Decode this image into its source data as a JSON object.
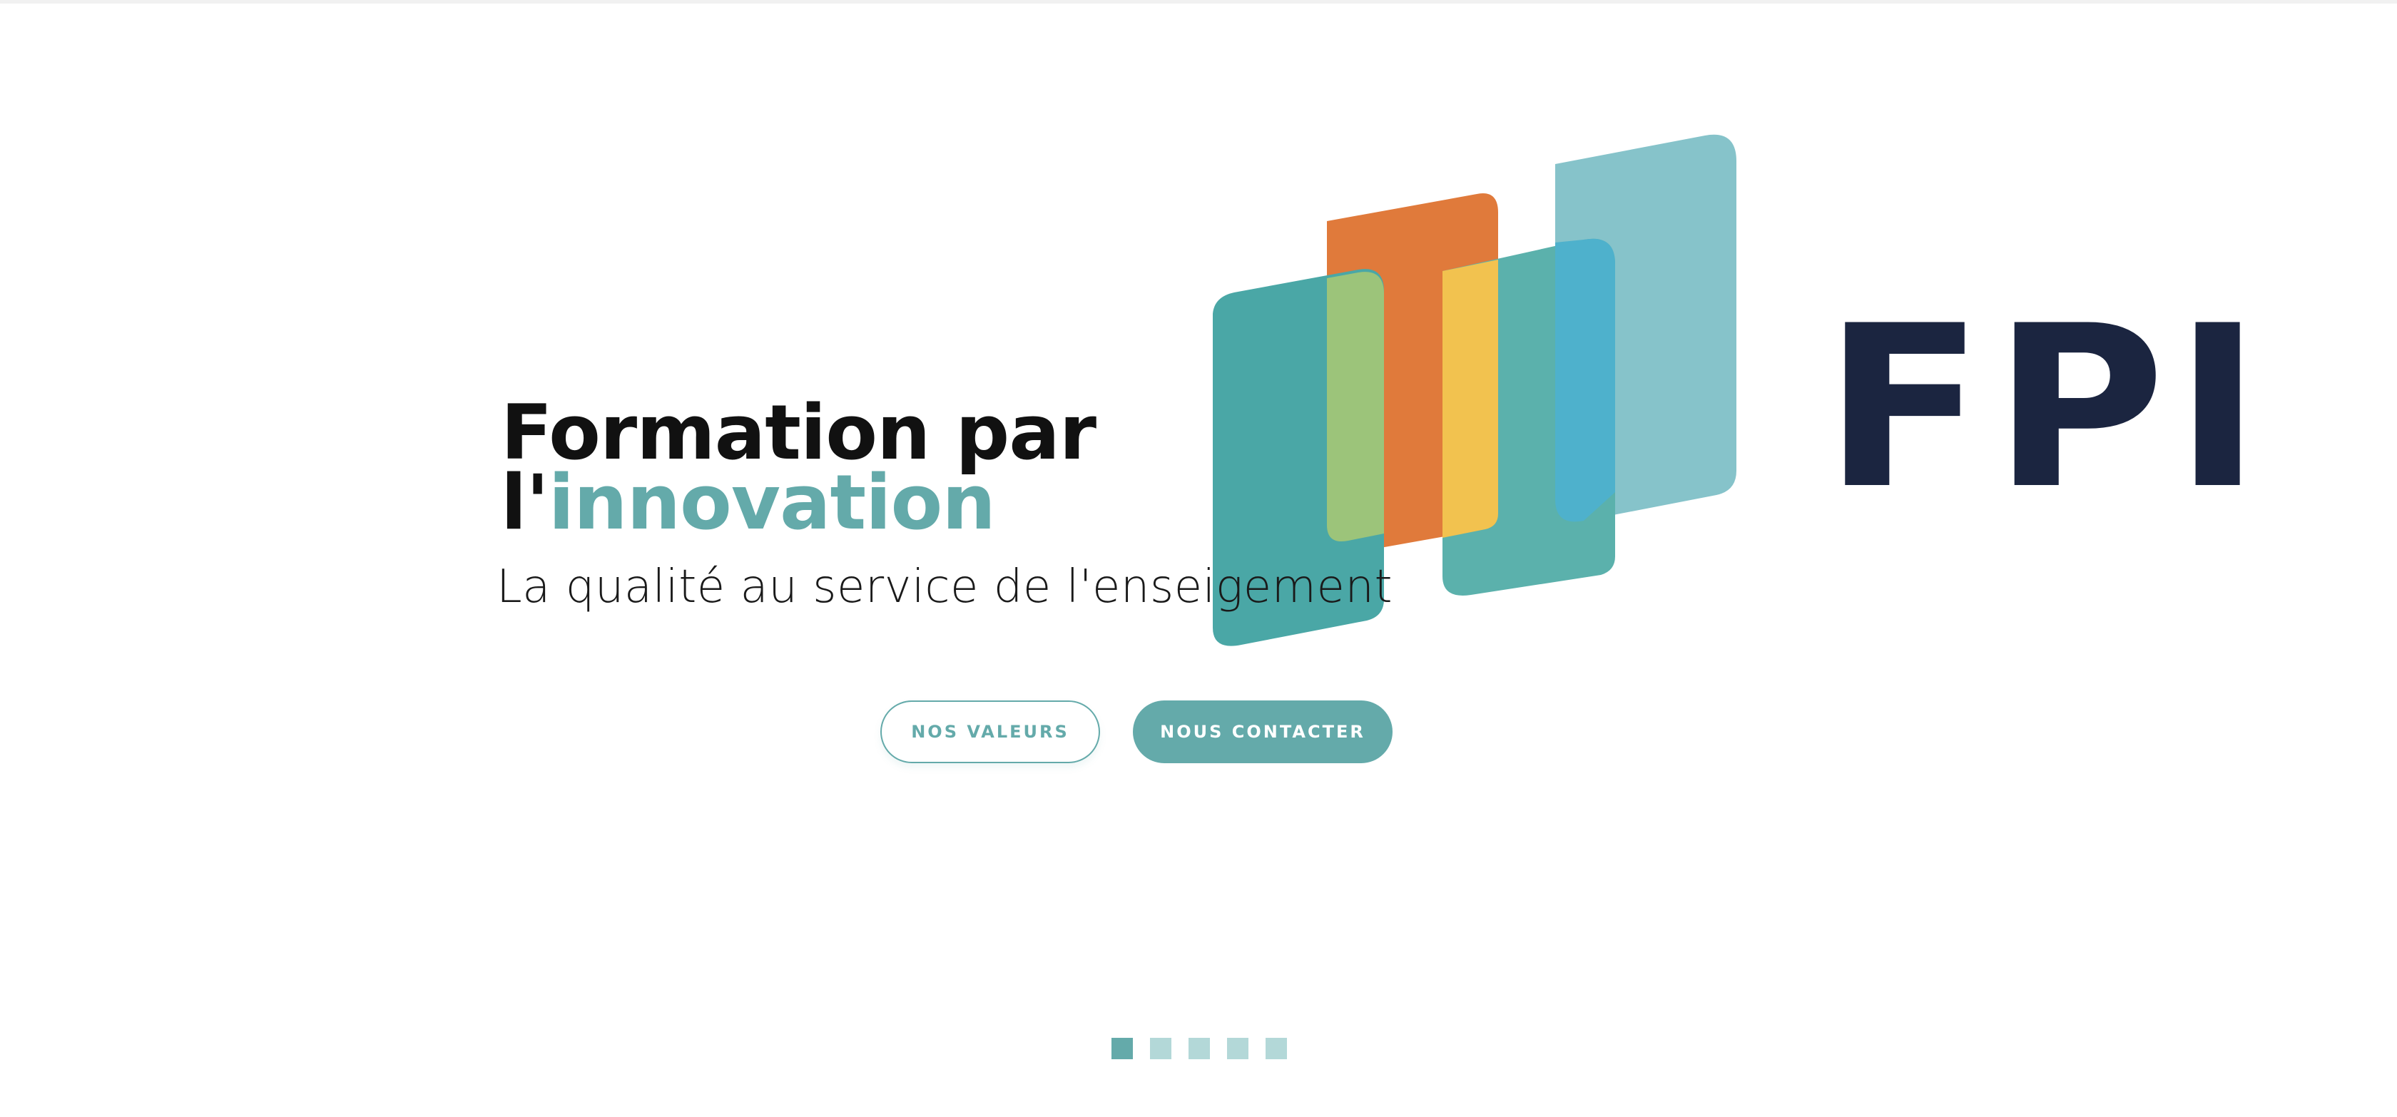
{
  "hero": {
    "title_line1": "Formation par",
    "title_line2_prefix": "l'",
    "title_line2_accent": "innovation",
    "subtitle": "La qualité au service de l'enseigement",
    "buttons": {
      "values_label": "NOS VALEURS",
      "contact_label": "NOUS CONTACTER"
    }
  },
  "logo": {
    "wordmark": "FPI"
  },
  "carousel": {
    "slide_count": 5,
    "active_index": 0
  },
  "colors": {
    "accent": "#64aaaa",
    "accent_light": "#b3d8d8",
    "navy": "#1b2540",
    "teal_dark": "#4aa7a6",
    "orange": "#e07a3b",
    "yellow": "#f2c24f",
    "teal_light": "#7fc0c7",
    "green": "#9cc47a",
    "blue": "#4eb1cc"
  }
}
